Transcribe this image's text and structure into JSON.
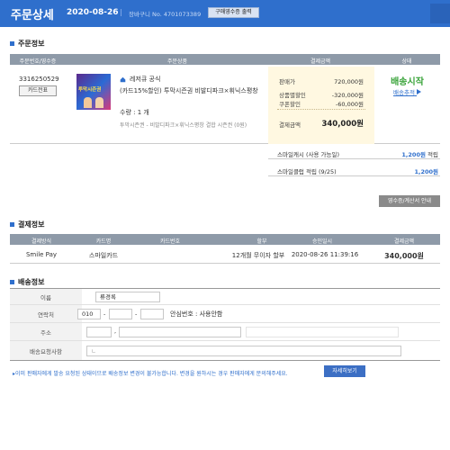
{
  "header": {
    "title": "주문상세",
    "date": "2020-08-26",
    "separator": "|",
    "cart_no": "장바구니 No. 4701073389",
    "receipt_button": "구매영수증 출력"
  },
  "order_info": {
    "section_title": "주문정보",
    "columns": [
      "주문번호/영수증",
      "주문상품",
      "결제금액",
      "상태"
    ],
    "order_no": "3316250529",
    "card_receipt_button": "카드전표",
    "thumb_text": "투막시즌권",
    "seller": "레저큐 공식",
    "product_name": "(카드15%할인) 투막시즌권 비발디파크×휘닉스평창",
    "quantity": "수량 : 1 개",
    "option": "투막시즌권 - 비발디파크×휘닉스평창 결합 시즌권 (0원)",
    "price_label": "판매가",
    "price": "720,000원",
    "product_discount_label": "상품별할인",
    "product_discount": "-320,000원",
    "coupon_label": "쿠폰할인",
    "coupon_discount": "-60,000원",
    "total_label": "결제금액",
    "total": "340,000원",
    "status": "배송시작",
    "tracking_link": "배송추적",
    "smile_cash_label": "스마일캐시 (사용 가능일)",
    "smile_cash_value": "1,200원",
    "smile_cash_suffix": "적립",
    "smile_club_label": "스마일클럽 적립 (9/25)",
    "smile_club_value": "1,200원",
    "receipt_guide_button": "영수증/계산서 안내"
  },
  "payment_info": {
    "section_title": "결제정보",
    "columns": [
      "결제방식",
      "카드명",
      "카드번호",
      "할부",
      "승인일시",
      "결제금액"
    ],
    "row": [
      "Smile Pay",
      "스마일카드",
      "",
      "12개월 무이자 할부",
      "2020-08-26 11:39:16",
      "340,000원"
    ]
  },
  "shipping_info": {
    "section_title": "배송정보",
    "name_label": "이름",
    "name_value": "류경록",
    "phone_label": "연락처",
    "phone_prefix": "010",
    "phone_dash": "-",
    "safe_number": "안심번호 : 사용안함",
    "address_label": "주소",
    "address_sep": ",",
    "request_label": "배송요청사항",
    "request_icon": "ㄴ"
  },
  "notice": {
    "text": "▸이미 판매자에게 발송 요청된 상태이므로 배송정보 변경이 불가능합니다. 변경을 원하시는 경우 판매자에게 문의해주세요.",
    "detail_button": "자세히보기"
  },
  "colors": {
    "header_blue": "#2f6fcc",
    "status_green": "#39a33a",
    "table_header_gray": "#8e9aa8",
    "pay_box_yellow": "#fff8e1"
  },
  "icons": [
    "home-icon",
    "arrow-right-icon",
    "bullet-icon"
  ]
}
